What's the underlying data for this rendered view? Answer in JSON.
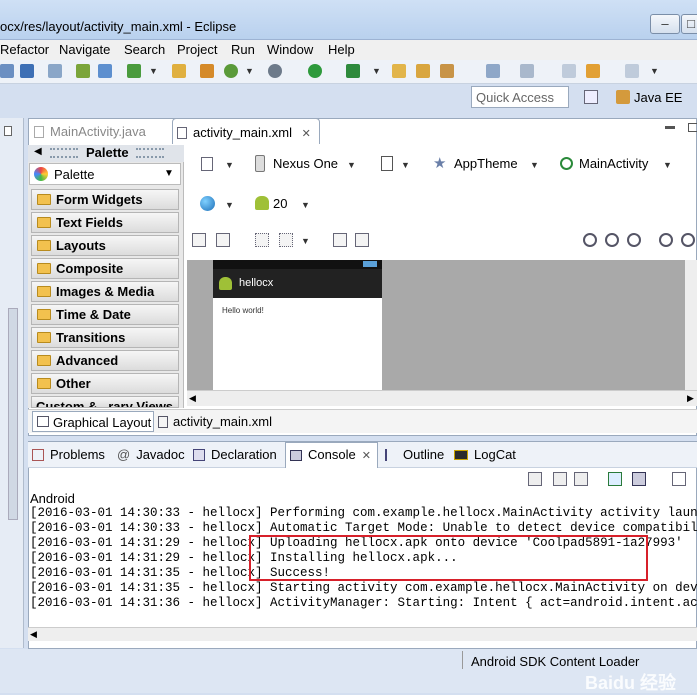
{
  "window": {
    "title": "ocx/res/layout/activity_main.xml - Eclipse",
    "minimize": "–",
    "maximize": "□"
  },
  "menu": [
    "Refactor",
    "Navigate",
    "Search",
    "Project",
    "Run",
    "Window",
    "Help"
  ],
  "quick_access": "Quick Access",
  "perspective": "Java EE",
  "editor_tabs": [
    {
      "label": "MainActivity.java"
    },
    {
      "label": "activity_main.xml",
      "close": "✕"
    }
  ],
  "palette": {
    "header": "Palette",
    "dropdown": "Palette",
    "categories": [
      "Form Widgets",
      "Text Fields",
      "Layouts",
      "Composite",
      "Images & Media",
      "Time & Date",
      "Transitions",
      "Advanced",
      "Other",
      "Custom &...rary Views"
    ]
  },
  "layout_toolbar": {
    "device": "Nexus One",
    "theme": "AppTheme",
    "activity": "MainActivity",
    "api": "20"
  },
  "preview": {
    "app_title": "hellocx",
    "text": "Hello world!"
  },
  "bottom_tabs": [
    "Graphical Layout",
    "activity_main.xml"
  ],
  "console_tabs": [
    "Problems",
    "Javadoc",
    "Declaration",
    "Console",
    "Outline",
    "LogCat"
  ],
  "console_label": "Android",
  "console_lines": [
    "[2016-03-01 14:30:33 - hellocx] Performing com.example.hellocx.MainActivity activity launch",
    "[2016-03-01 14:30:33 - hellocx] Automatic Target Mode: Unable to detect device compatibility. P",
    "[2016-03-01 14:31:29 - hellocx] Uploading hellocx.apk onto device 'Coolpad5891-1a27993'",
    "[2016-03-01 14:31:29 - hellocx] Installing hellocx.apk...",
    "[2016-03-01 14:31:35 - hellocx] Success!",
    "[2016-03-01 14:31:35 - hellocx] Starting activity com.example.hellocx.MainActivity on device Co",
    "[2016-03-01 14:31:36 - hellocx] ActivityManager: Starting: Intent { act=android.intent.action.M"
  ],
  "status": "Android SDK Content Loader",
  "watermark": "Baidu 经验",
  "colors": {
    "highlight": "#d7202a",
    "android_green": "#9fc037",
    "titlebar": "#b9d1ee"
  }
}
